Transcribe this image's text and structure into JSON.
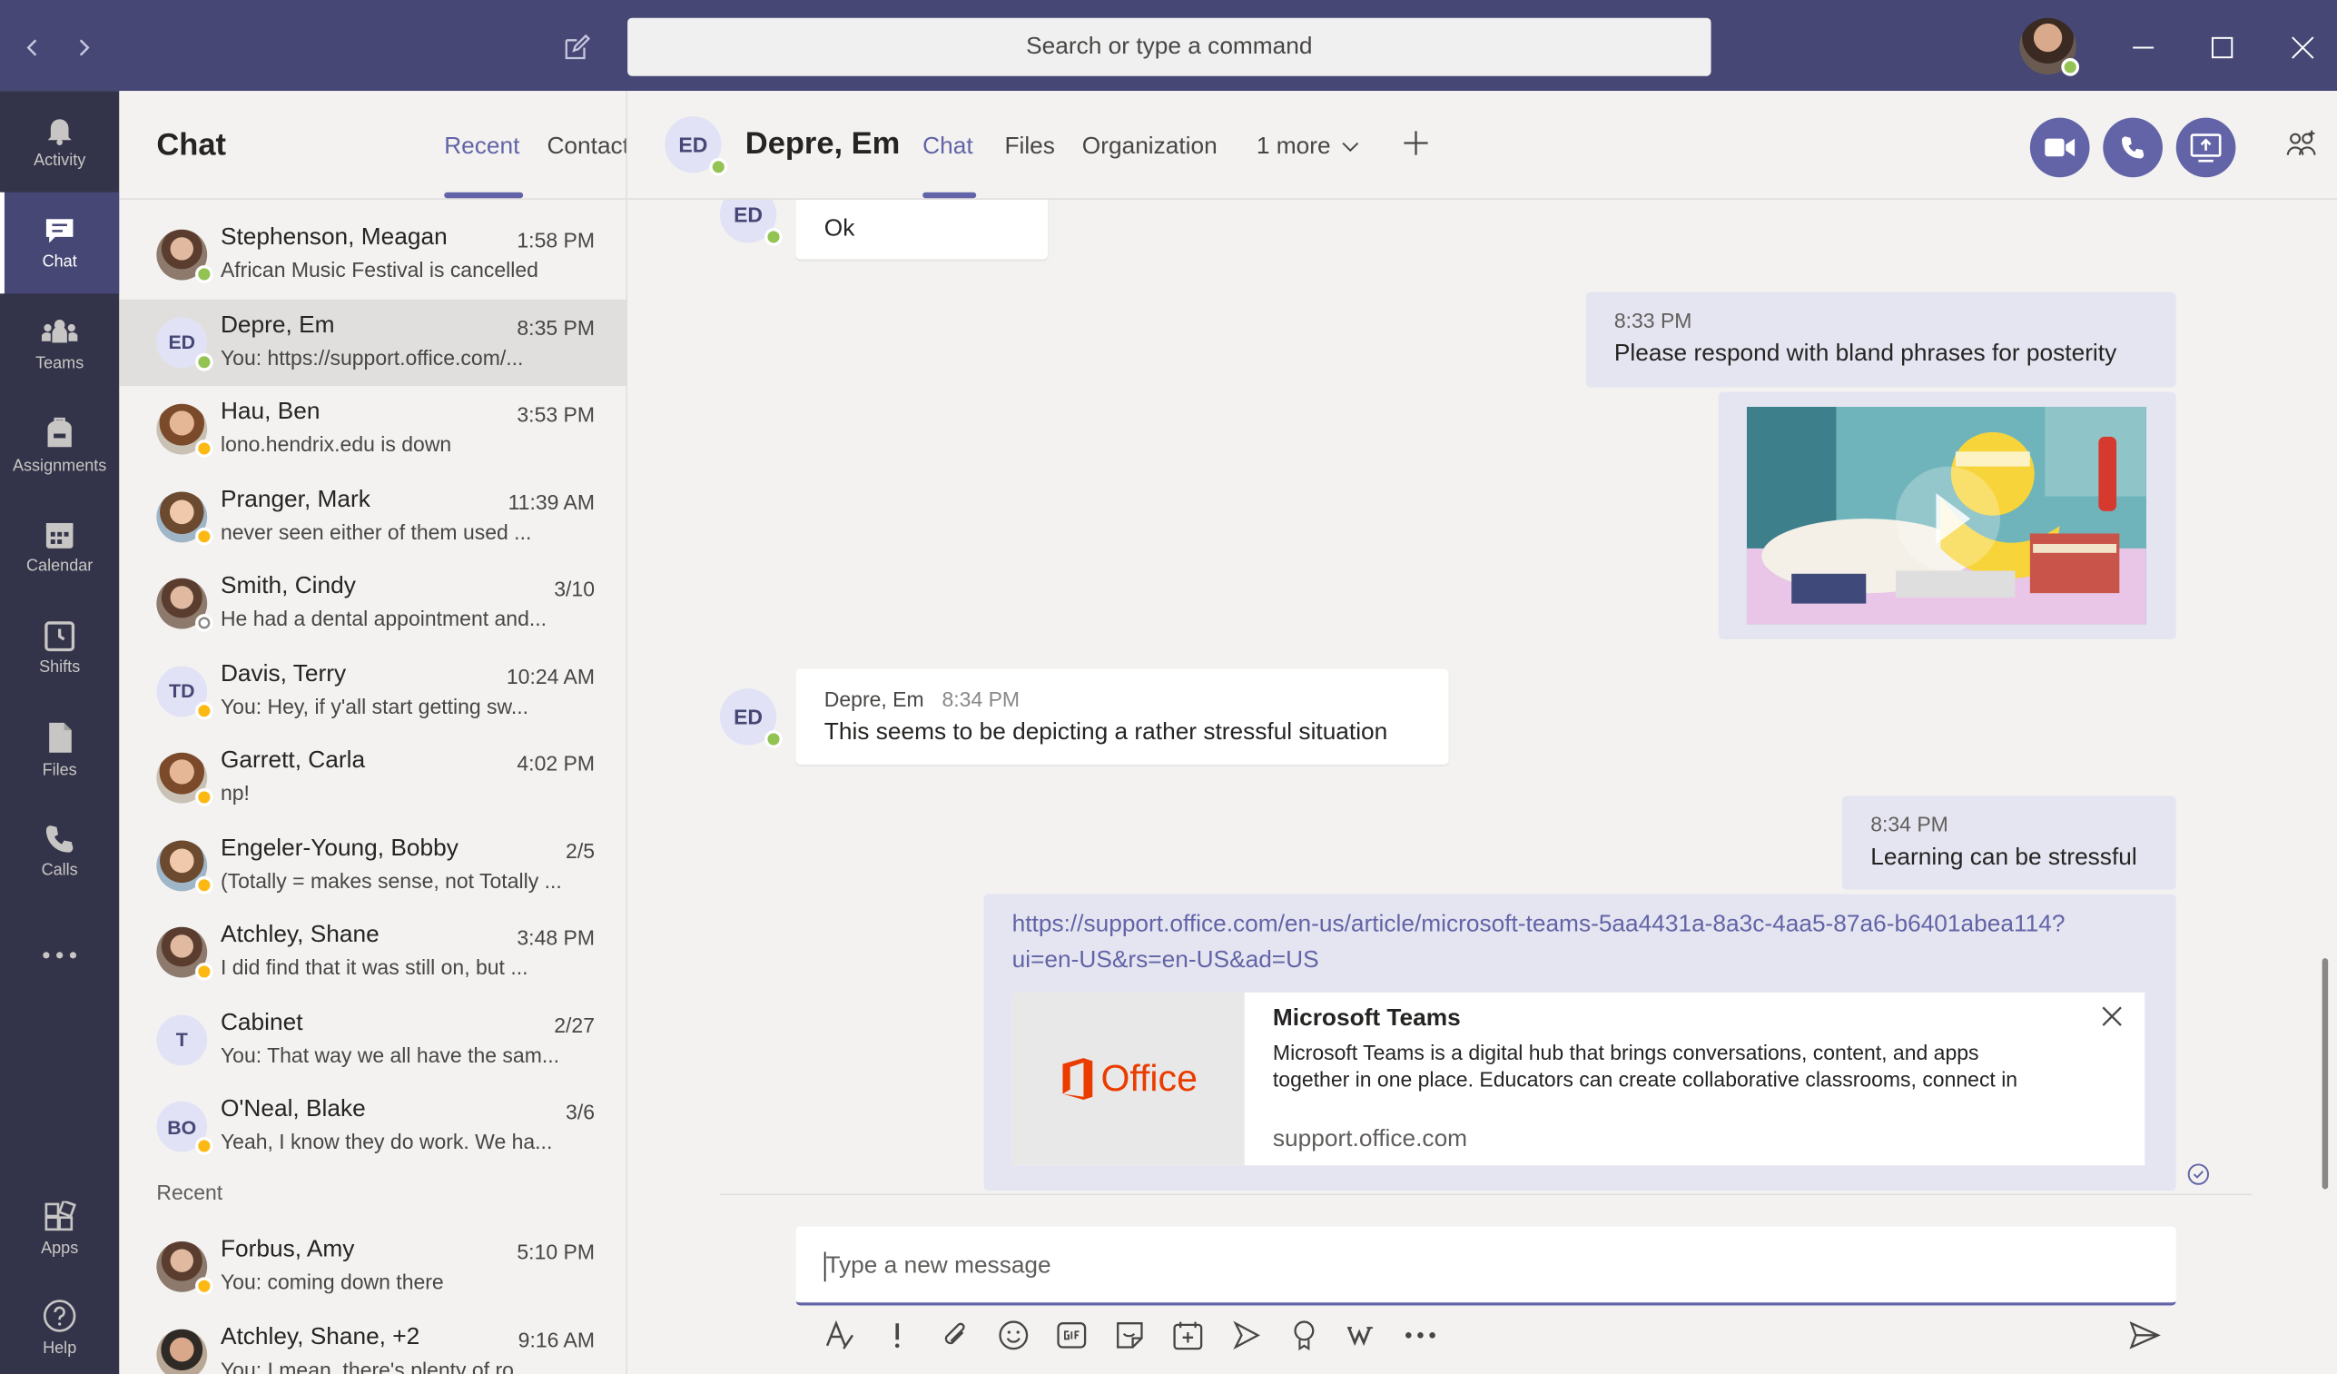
{
  "titlebar": {
    "search_placeholder": "Search or type a command"
  },
  "rail": [
    {
      "label": "Activity",
      "icon": "bell-icon"
    },
    {
      "label": "Chat",
      "icon": "chat-icon"
    },
    {
      "label": "Teams",
      "icon": "teams-icon"
    },
    {
      "label": "Assignments",
      "icon": "assignments-icon"
    },
    {
      "label": "Calendar",
      "icon": "calendar-icon"
    },
    {
      "label": "Shifts",
      "icon": "clock-icon"
    },
    {
      "label": "Files",
      "icon": "file-icon"
    },
    {
      "label": "Calls",
      "icon": "phone-icon"
    },
    {
      "label": "Apps",
      "icon": "apps-icon"
    },
    {
      "label": "Help",
      "icon": "help-icon"
    }
  ],
  "chat_list": {
    "title": "Chat",
    "tabs": [
      "Recent",
      "Contacts"
    ],
    "items": [
      {
        "name": "Stephenson, Meagan",
        "time": "1:58 PM",
        "preview": "African Music Festival is cancelled",
        "initials": "",
        "status": "green"
      },
      {
        "name": "Depre, Em",
        "time": "8:35 PM",
        "preview": "You: https://support.office.com/...",
        "initials": "ED",
        "status": "green"
      },
      {
        "name": "Hau, Ben",
        "time": "3:53 PM",
        "preview": "lono.hendrix.edu is down",
        "initials": "",
        "status": "yellow"
      },
      {
        "name": "Pranger, Mark",
        "time": "11:39 AM",
        "preview": "never seen either of them used ...",
        "initials": "",
        "status": "yellow"
      },
      {
        "name": "Smith, Cindy",
        "time": "3/10",
        "preview": "He had a dental appointment and...",
        "initials": "",
        "status": "gray"
      },
      {
        "name": "Davis, Terry",
        "time": "10:24 AM",
        "preview": "You: Hey, if y'all start getting sw...",
        "initials": "TD",
        "status": "yellow"
      },
      {
        "name": "Garrett, Carla",
        "time": "4:02 PM",
        "preview": "np!",
        "initials": "",
        "status": "yellow"
      },
      {
        "name": "Engeler-Young, Bobby",
        "time": "2/5",
        "preview": "(Totally = makes sense, not Totally ...",
        "initials": "",
        "status": "yellow"
      },
      {
        "name": "Atchley, Shane",
        "time": "3:48 PM",
        "preview": "I did find that it was still on, but ...",
        "initials": "",
        "status": "yellow"
      },
      {
        "name": "Cabinet",
        "time": "2/27",
        "preview": "You: That way we all have the sam...",
        "initials": "T",
        "status": "none"
      },
      {
        "name": "O'Neal, Blake",
        "time": "3/6",
        "preview": "Yeah, I know they do work. We ha...",
        "initials": "BO",
        "status": "yellow"
      }
    ],
    "section_label": "Recent",
    "recent_items": [
      {
        "name": "Forbus, Amy",
        "time": "5:10 PM",
        "preview": "You: coming down there",
        "initials": "",
        "status": "yellow"
      },
      {
        "name": "Atchley, Shane, +2",
        "time": "9:16 AM",
        "preview": "You: I mean, there's plenty of ro...",
        "initials": "",
        "status": "none"
      }
    ]
  },
  "conversation": {
    "contact_initials": "ED",
    "contact_name": "Depre, Em",
    "tabs": [
      "Chat",
      "Files",
      "Organization",
      "1 more"
    ],
    "messages": {
      "m1_text": "Ok",
      "m2_time": "8:33 PM",
      "m2_text": "Please respond with bland phrases for posterity",
      "m3_sender": "Depre, Em",
      "m3_time": "8:34 PM",
      "m3_text": "This seems to be depicting a rather stressful situation",
      "m4_time": "8:34 PM",
      "m4_text": "Learning can be stressful",
      "m5_link_line1": "https://support.office.com/en-us/article/microsoft-teams-5aa4431a-8a3c-4aa5-87a6-b6401abea114?",
      "m5_link_line2": "ui=en-US&rs=en-US&ad=US",
      "card_title": "Microsoft Teams",
      "card_desc": "Microsoft Teams is a digital hub that brings conversations, content, and apps together in one place. Educators can create collaborative classrooms, connect in",
      "card_domain": "support.office.com",
      "card_logo_text": "Office"
    },
    "composer_placeholder": "Type a new message"
  },
  "colors": {
    "brand": "#6264a7",
    "titlebar": "#464775",
    "rail": "#33344a",
    "presence_available": "#92c353",
    "presence_away": "#fdb913",
    "office_orange": "#eb3c00"
  }
}
